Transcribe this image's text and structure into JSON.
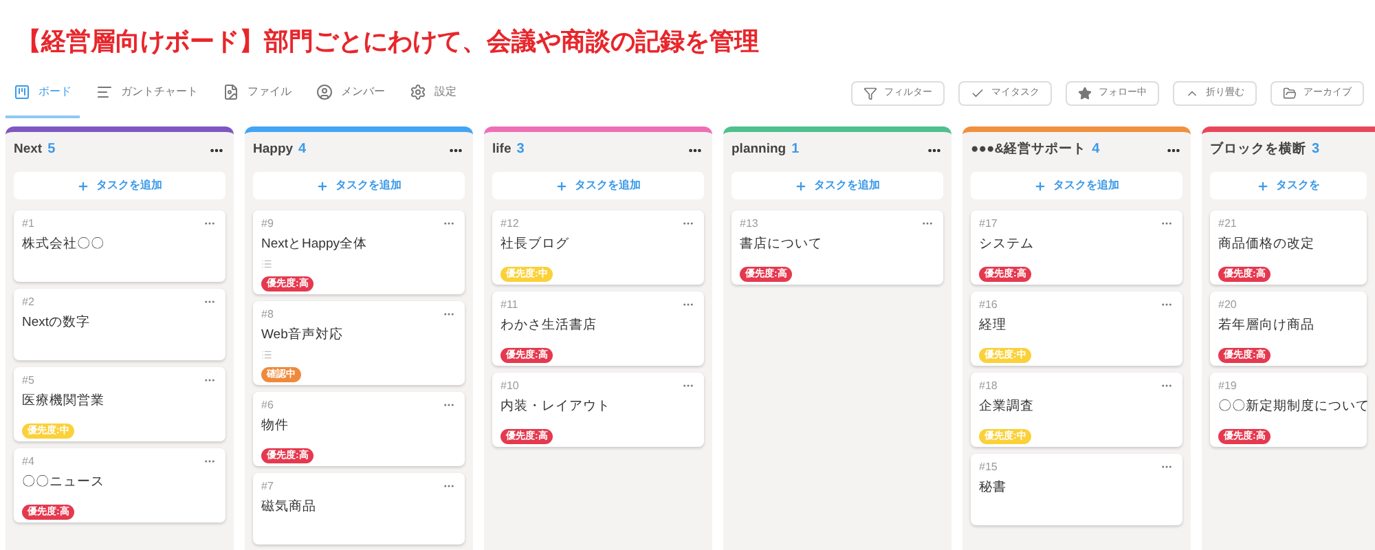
{
  "headline": "【経営層向けボード】部門ごとにわけて、会議や商談の記録を管理",
  "tabs": [
    {
      "label": "ボード",
      "selected": true
    },
    {
      "label": "ガントチャート",
      "selected": false
    },
    {
      "label": "ファイル",
      "selected": false
    },
    {
      "label": "メンバー",
      "selected": false
    },
    {
      "label": "設定",
      "selected": false
    }
  ],
  "toolbar": [
    {
      "label": "フィルター"
    },
    {
      "label": "マイタスク"
    },
    {
      "label": "フォロー中"
    },
    {
      "label": "折り畳む"
    },
    {
      "label": "アーカイブ"
    }
  ],
  "columns": [
    {
      "name": "Next",
      "count": "5",
      "color": "#7e57c2",
      "menu": true,
      "add_label": "タスクを追加",
      "cards": [
        {
          "number": "#1",
          "title": "株式会社〇〇",
          "description_icon": false,
          "menu": true
        },
        {
          "number": "#2",
          "title": "Nextの数字",
          "description_icon": false,
          "menu": true
        },
        {
          "number": "#5",
          "title": "医療機関営業",
          "description_icon": false,
          "menu": true,
          "badge": {
            "label": "優先度:中",
            "color": "#fbd13a"
          }
        },
        {
          "number": "#4",
          "title": "〇〇ニュース",
          "description_icon": false,
          "menu": true,
          "badge": {
            "label": "優先度:高",
            "color": "#e5394f"
          }
        }
      ]
    },
    {
      "name": "Happy",
      "count": "4",
      "color": "#42a5f5",
      "menu": true,
      "add_label": "タスクを追加",
      "cards": [
        {
          "number": "#9",
          "title": "NextとHappy全体",
          "description_icon": true,
          "menu": true,
          "badge": {
            "label": "優先度:高",
            "color": "#e5394f"
          }
        },
        {
          "number": "#8",
          "title": "Web音声対応",
          "description_icon": true,
          "menu": true,
          "badge": {
            "label": "確認中",
            "color": "#ef8a3c"
          }
        },
        {
          "number": "#6",
          "title": "物件",
          "description_icon": false,
          "menu": true,
          "badge": {
            "label": "優先度:高",
            "color": "#e5394f"
          }
        },
        {
          "number": "#7",
          "title": "磁気商品",
          "description_icon": false,
          "menu": true
        }
      ]
    },
    {
      "name": "life",
      "count": "3",
      "color": "#ee6fb6",
      "menu": true,
      "add_label": "タスクを追加",
      "cards": [
        {
          "number": "#12",
          "title": "社長ブログ",
          "description_icon": false,
          "menu": true,
          "badge": {
            "label": "優先度:中",
            "color": "#fbd13a"
          }
        },
        {
          "number": "#11",
          "title": "わかさ生活書店",
          "description_icon": false,
          "menu": true,
          "badge": {
            "label": "優先度:高",
            "color": "#e5394f"
          }
        },
        {
          "number": "#10",
          "title": "内装・レイアウト",
          "description_icon": false,
          "menu": true,
          "badge": {
            "label": "優先度:高",
            "color": "#e5394f"
          }
        }
      ]
    },
    {
      "name": "planning",
      "count": "1",
      "color": "#4fc08d",
      "menu": true,
      "add_label": "タスクを追加",
      "cards": [
        {
          "number": "#13",
          "title": "書店について",
          "description_icon": false,
          "menu": true,
          "badge": {
            "label": "優先度:高",
            "color": "#e5394f"
          }
        }
      ]
    },
    {
      "name": "●●●&経営サポート",
      "count": "4",
      "color": "#f0913f",
      "menu": true,
      "add_label": "タスクを追加",
      "cards": [
        {
          "number": "#17",
          "title": "システム",
          "description_icon": false,
          "menu": true,
          "badge": {
            "label": "優先度:高",
            "color": "#e5394f"
          }
        },
        {
          "number": "#16",
          "title": "経理",
          "description_icon": false,
          "menu": true,
          "badge": {
            "label": "優先度:中",
            "color": "#fbd13a"
          }
        },
        {
          "number": "#18",
          "title": "企業調査",
          "description_icon": false,
          "menu": true,
          "badge": {
            "label": "優先度:中",
            "color": "#fbd13a"
          }
        },
        {
          "number": "#15",
          "title": "秘書",
          "description_icon": false,
          "menu": true
        }
      ]
    },
    {
      "name": "ブロックを横断",
      "count": "3",
      "color": "#e8475b",
      "menu": false,
      "add_label": "タスクを",
      "cards": [
        {
          "number": "#21",
          "title": "商品価格の改定",
          "description_icon": false,
          "menu": false,
          "badge": {
            "label": "優先度:高",
            "color": "#e5394f"
          }
        },
        {
          "number": "#20",
          "title": "若年層向け商品",
          "description_icon": false,
          "menu": false,
          "badge": {
            "label": "優先度:高",
            "color": "#e5394f"
          }
        },
        {
          "number": "#19",
          "title": "〇〇新定期制度について",
          "description_icon": false,
          "menu": false,
          "badge": {
            "label": "優先度:高",
            "color": "#e5394f"
          }
        }
      ]
    }
  ]
}
